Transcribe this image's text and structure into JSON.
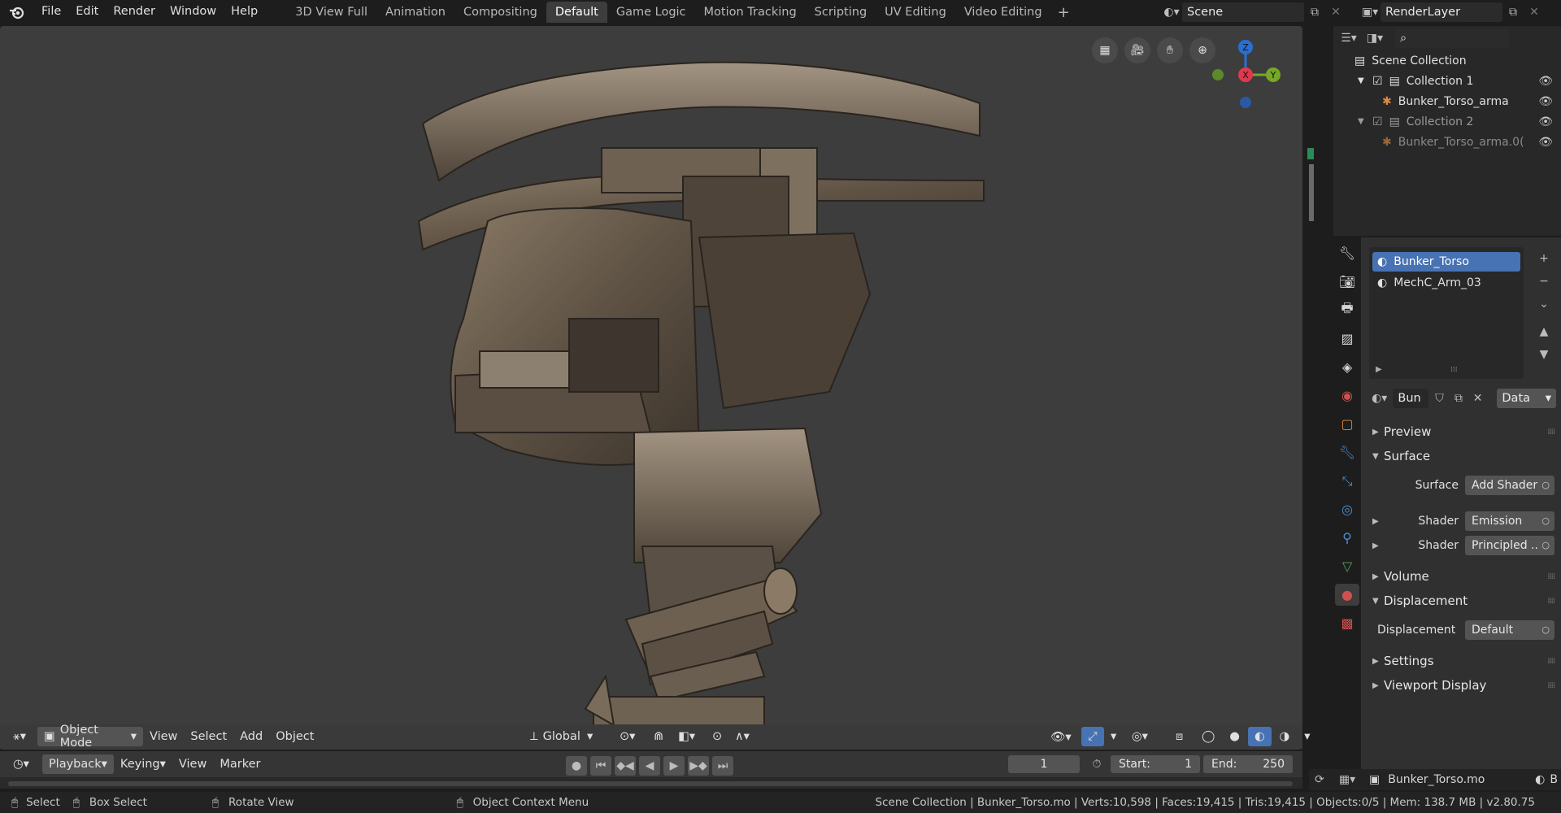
{
  "topbar": {
    "menus": [
      "File",
      "Edit",
      "Render",
      "Window",
      "Help"
    ],
    "workspaces": [
      "3D View Full",
      "Animation",
      "Compositing",
      "Default",
      "Game Logic",
      "Motion Tracking",
      "Scripting",
      "UV Editing",
      "Video Editing"
    ],
    "active_workspace": "Default",
    "add_workspace": "+",
    "scene": "Scene",
    "render_layer": "RenderLayer"
  },
  "viewport": {
    "header": {
      "mode": "Object Mode",
      "menus": [
        "View",
        "Select",
        "Add",
        "Object"
      ],
      "orientation": "Global"
    },
    "gizmo": {
      "x": "X",
      "y": "Y",
      "z": "Z"
    }
  },
  "timeline": {
    "menus": [
      "Playback",
      "Keying",
      "View",
      "Marker"
    ],
    "current_frame": "1",
    "start_label": "Start:",
    "start": "1",
    "end_label": "End:",
    "end": "250"
  },
  "statusbar": {
    "select": "Select",
    "box_select": "Box Select",
    "rotate_view": "Rotate View",
    "context_menu": "Object Context Menu",
    "stats": "Scene Collection | Bunker_Torso.mo | Verts:10,598 | Faces:19,415 | Tris:19,415 | Objects:0/5 | Mem: 138.7 MB | v2.80.75"
  },
  "outliner": {
    "root": "Scene Collection",
    "rows": [
      {
        "label": "Collection 1",
        "level": 1,
        "kind": "collection",
        "dim": false
      },
      {
        "label": "Bunker_Torso_arma",
        "level": 2,
        "kind": "armature",
        "dim": false
      },
      {
        "label": "Collection 2",
        "level": 1,
        "kind": "collection",
        "dim": true
      },
      {
        "label": "Bunker_Torso_arma.0(",
        "level": 2,
        "kind": "armature",
        "dim": true
      }
    ]
  },
  "properties": {
    "materials": [
      "Bunker_Torso",
      "MechC_Arm_03"
    ],
    "active_material": "Bunker_Torso",
    "material_name_short": "Bun",
    "link": "Data",
    "panels": {
      "preview": "Preview",
      "surface": "Surface",
      "surface_label": "Surface",
      "surface_value": "Add Shader",
      "shader_label": "Shader",
      "shader1": "Emission",
      "shader2": "Principled ..",
      "volume": "Volume",
      "displacement": "Displacement",
      "displacement_label": "Displacement",
      "displacement_value": "Default",
      "settings": "Settings",
      "viewport_display": "Viewport Display"
    },
    "footer_object": "Bunker_Torso.mo",
    "footer_trail": "B"
  }
}
